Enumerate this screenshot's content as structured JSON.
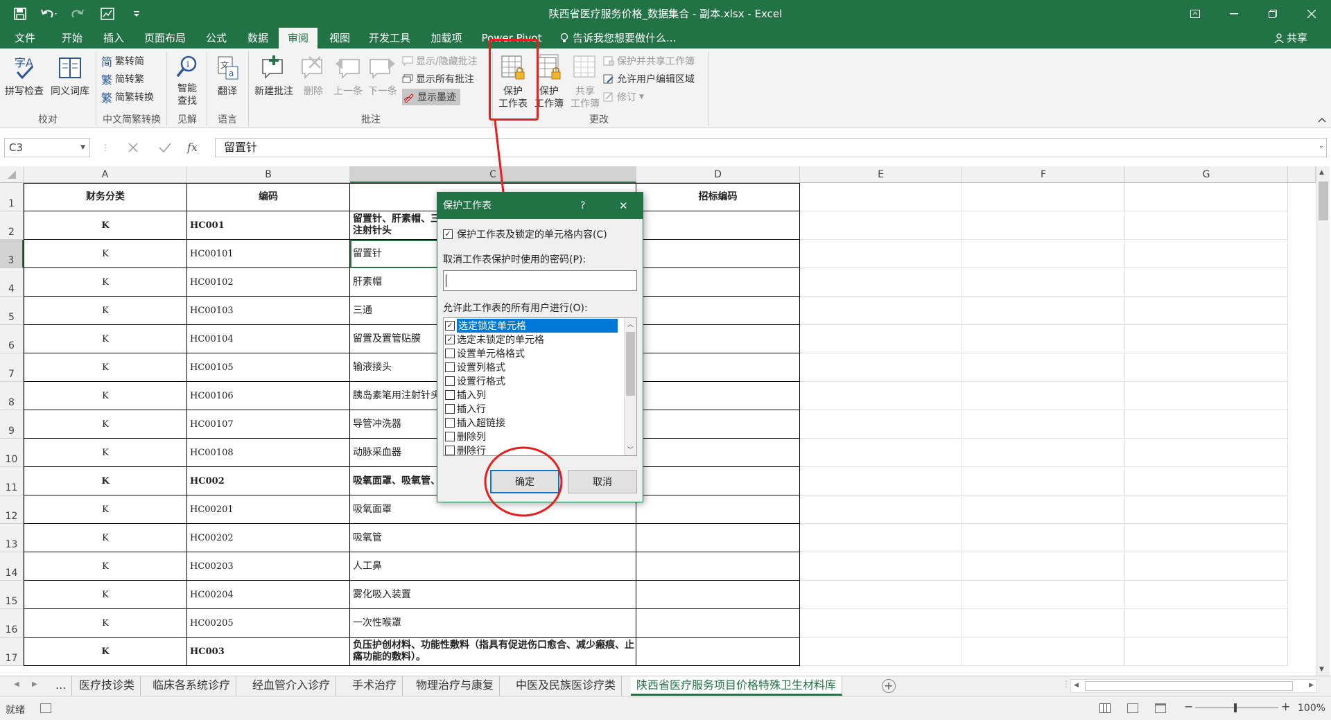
{
  "app": {
    "title": "陕西省医疗服务价格_数据集合 - 副本.xlsx - Excel",
    "share_label": "共享"
  },
  "ribbon_tabs": [
    "文件",
    "开始",
    "插入",
    "页面布局",
    "公式",
    "数据",
    "审阅",
    "视图",
    "开发工具",
    "加载项",
    "Power Pivot"
  ],
  "active_tab": "审阅",
  "tell_me": "告诉我您想要做什么...",
  "ribbon": {
    "spell_check": "拼写检查",
    "thesaurus": "同义词库",
    "proofing_group": "校对",
    "trad_to_simp": "繁转简",
    "simp_to_trad": "简转繁",
    "simp_trad_convert": "简繁转换",
    "chinese_convert_group": "中文简繁转换",
    "smart_lookup": [
      "智能",
      "查找"
    ],
    "insights_group": "见解",
    "translate": "翻译",
    "language_group": "语言",
    "new_comment": "新建批注",
    "delete": "删除",
    "previous": "上一条",
    "next": "下一条",
    "show_hide_comment": "显示/隐藏批注",
    "show_all_comments": "显示所有批注",
    "show_ink": "显示墨迹",
    "comments_group": "批注",
    "protect_sheet": [
      "保护",
      "工作表"
    ],
    "protect_workbook": [
      "保护",
      "工作簿"
    ],
    "share_workbook": [
      "共享",
      "工作簿"
    ],
    "protect_share": "保护并共享工作簿",
    "allow_edit_ranges": "允许用户编辑区域",
    "track_changes": "修订",
    "changes_group": "更改"
  },
  "formula_bar": {
    "name_box": "C3",
    "fx": "fx",
    "content": "留置针"
  },
  "columns": [
    "A",
    "B",
    "C",
    "D",
    "E",
    "F",
    "G"
  ],
  "rows": [
    {
      "n": "1",
      "a": "财务分类",
      "b": "编码",
      "c": "",
      "d": "招标编码",
      "bold": true
    },
    {
      "n": "2",
      "a": "K",
      "b": "HC001",
      "c": "留置针、肝素帽、三通、留置及置管贴膜、输液接头、胰岛素笔用注射针头",
      "d": "",
      "bold": true
    },
    {
      "n": "3",
      "a": "K",
      "b": "HC00101",
      "c": "留置针",
      "d": ""
    },
    {
      "n": "4",
      "a": "K",
      "b": "HC00102",
      "c": "肝素帽",
      "d": ""
    },
    {
      "n": "5",
      "a": "K",
      "b": "HC00103",
      "c": "三通",
      "d": ""
    },
    {
      "n": "6",
      "a": "K",
      "b": "HC00104",
      "c": "留置及置管贴膜",
      "d": ""
    },
    {
      "n": "7",
      "a": "K",
      "b": "HC00105",
      "c": "输液接头",
      "d": ""
    },
    {
      "n": "8",
      "a": "K",
      "b": "HC00106",
      "c": "胰岛素笔用注射针头",
      "d": ""
    },
    {
      "n": "9",
      "a": "K",
      "b": "HC00107",
      "c": "导管冲洗器",
      "d": ""
    },
    {
      "n": "10",
      "a": "K",
      "b": "HC00108",
      "c": "动脉采血器",
      "d": ""
    },
    {
      "n": "11",
      "a": "K",
      "b": "HC002",
      "c": "吸氧面罩、吸氧管、人工鼻、雾化吸入装置、一次性喉罩。",
      "d": "",
      "bold": true
    },
    {
      "n": "12",
      "a": "K",
      "b": "HC00201",
      "c": "吸氧面罩",
      "d": ""
    },
    {
      "n": "13",
      "a": "K",
      "b": "HC00202",
      "c": "吸氧管",
      "d": ""
    },
    {
      "n": "14",
      "a": "K",
      "b": "HC00203",
      "c": "人工鼻",
      "d": ""
    },
    {
      "n": "15",
      "a": "K",
      "b": "HC00204",
      "c": "雾化吸入装置",
      "d": ""
    },
    {
      "n": "16",
      "a": "K",
      "b": "HC00205",
      "c": "一次性喉罩",
      "d": ""
    },
    {
      "n": "17",
      "a": "K",
      "b": "HC003",
      "c": "负压护创材料、功能性敷料（指具有促进伤口愈合、减少瘢痕、止痛功能的敷料）。",
      "d": "",
      "bold": true
    }
  ],
  "dialog": {
    "title": "保护工作表",
    "help": "?",
    "close": "✕",
    "protect_checkbox": "保护工作表及锁定的单元格内容(C)",
    "protect_checked": true,
    "password_label": "取消工作表保护时使用的密码(P):",
    "password_value": "",
    "allow_label": "允许此工作表的所有用户进行(O):",
    "options": [
      {
        "label": "选定锁定单元格",
        "checked": true,
        "selected": true
      },
      {
        "label": "选定未锁定的单元格",
        "checked": true
      },
      {
        "label": "设置单元格格式",
        "checked": false
      },
      {
        "label": "设置列格式",
        "checked": false
      },
      {
        "label": "设置行格式",
        "checked": false
      },
      {
        "label": "插入列",
        "checked": false
      },
      {
        "label": "插入行",
        "checked": false
      },
      {
        "label": "插入超链接",
        "checked": false
      },
      {
        "label": "删除列",
        "checked": false
      },
      {
        "label": "删除行",
        "checked": false
      }
    ],
    "ok": "确定",
    "cancel": "取消"
  },
  "sheet_tabs": [
    "...",
    "医疗技诊类",
    "临床各系统诊疗",
    "经血管介入诊疗",
    "手术治疗",
    "物理治疗与康复",
    "中医及民族医诊疗类",
    "陕西省医疗服务项目价格特殊卫生材料库"
  ],
  "active_sheet": "陕西省医疗服务项目价格特殊卫生材料库",
  "status": {
    "ready": "就绪",
    "zoom": "100%"
  },
  "colors": {
    "accent": "#217346",
    "annotation": "#e81d1d"
  }
}
